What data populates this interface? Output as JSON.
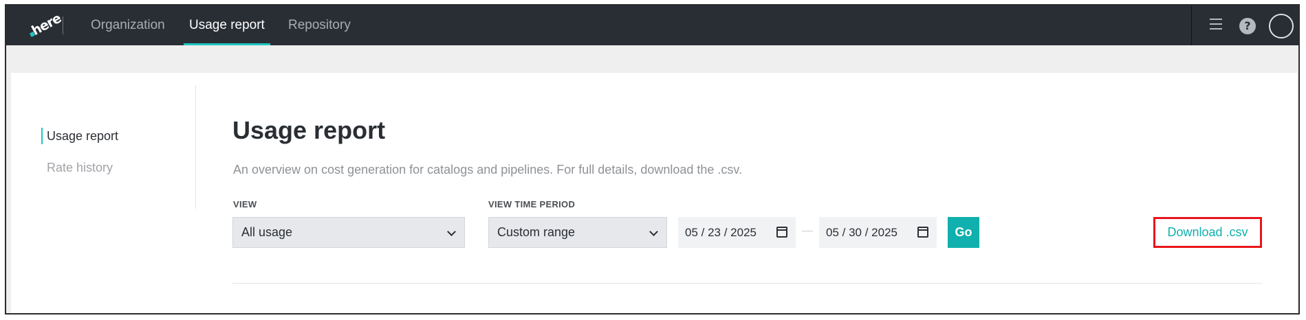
{
  "header": {
    "logo_text": "here",
    "tabs": [
      {
        "label": "Organization",
        "active": false
      },
      {
        "label": "Usage report",
        "active": true
      },
      {
        "label": "Repository",
        "active": false
      }
    ],
    "icons": [
      "menu-icon",
      "help-icon",
      "avatar"
    ],
    "help_glyph": "?"
  },
  "sidebar": {
    "items": [
      {
        "label": "Usage report",
        "active": true
      },
      {
        "label": "Rate history",
        "active": false
      }
    ]
  },
  "main": {
    "title": "Usage report",
    "description": "An overview on cost generation for catalogs and pipelines. For full details, download the .csv.",
    "view": {
      "label": "VIEW",
      "selected": "All usage"
    },
    "period": {
      "label": "VIEW TIME PERIOD",
      "selected": "Custom range"
    },
    "date_start": "05 / 23 / 2025",
    "date_end": "05 / 30 / 2025",
    "go_label": "Go",
    "download_label": "Download .csv"
  },
  "colors": {
    "accent": "#1ec6c0",
    "button": "#0fb0ad",
    "topbar": "#292e35",
    "highlight_box": "#e8141b"
  }
}
